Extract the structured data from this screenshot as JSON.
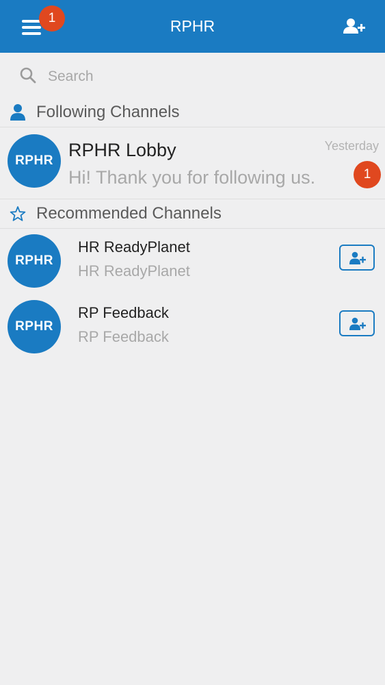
{
  "header": {
    "title": "RPHR",
    "menu_badge": "1",
    "menu_icon": "hamburger-menu-icon",
    "add_icon": "add-user-icon"
  },
  "search": {
    "placeholder": "Search",
    "value": ""
  },
  "following": {
    "label": "Following Channels",
    "icon": "person-icon",
    "items": [
      {
        "avatar": "RPHR",
        "name": "RPHR Lobby",
        "time": "Yesterday",
        "preview": "Hi! Thank you for following us.",
        "unread": "1"
      }
    ]
  },
  "recommended": {
    "label": "Recommended Channels",
    "icon": "star-outline-icon",
    "items": [
      {
        "avatar": "RPHR",
        "name": "HR ReadyPlanet",
        "subtitle": "HR ReadyPlanet"
      },
      {
        "avatar": "RPHR",
        "name": "RP Feedback",
        "subtitle": "RP Feedback"
      }
    ]
  },
  "colors": {
    "brand": "#1a7bc2",
    "badge": "#e0481f",
    "background": "#efeff0"
  }
}
